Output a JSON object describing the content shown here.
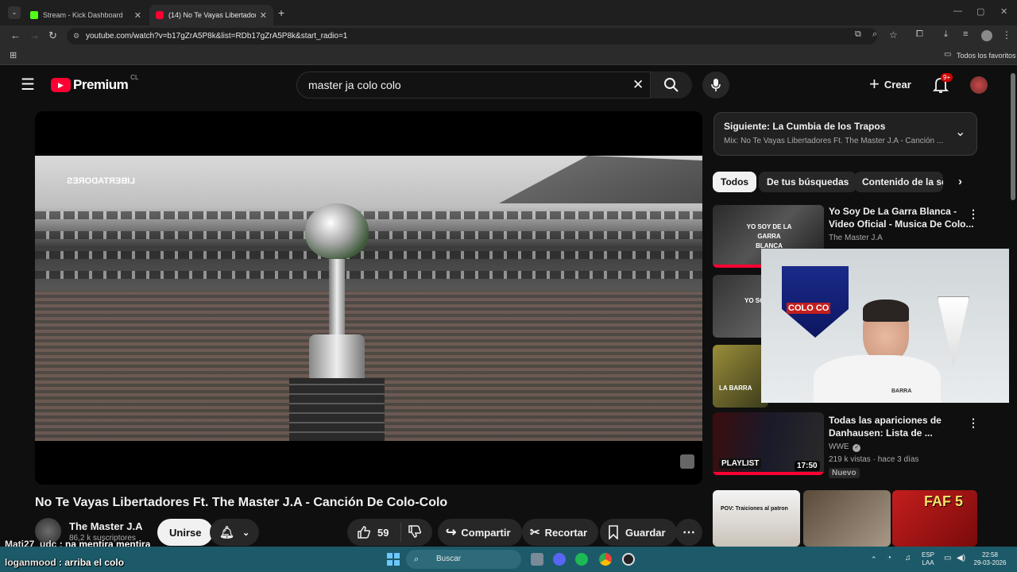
{
  "browser": {
    "tabs": [
      {
        "label": "Stream - Kick Dashboard",
        "favicon_color": "#53fc18"
      },
      {
        "label": "(14) No Te Vayas Libertadores f",
        "favicon_color": "#ff0033"
      }
    ],
    "url": "youtube.com/watch?v=b17gZrA5P8k&list=RDb17gZrA5P8k&start_radio=1",
    "bookmarks_label": "Todos los favoritos"
  },
  "youtube": {
    "logo_text": "Premium",
    "country_code": "CL",
    "search_value": "master ja colo colo",
    "create_label": "Crear",
    "notifications_badge": "9+"
  },
  "video": {
    "title": "No Te Vayas Libertadores Ft. The Master J.A - Canción De Colo-Colo",
    "overlay_text": "LIBERTADORES",
    "channel_name": "The Master J.A",
    "subscribers": "86,2 k suscriptores",
    "join_label": "Unirse",
    "likes": "59",
    "share_label": "Compartir",
    "clip_label": "Recortar",
    "save_label": "Guardar"
  },
  "sidebar": {
    "next_title": "Siguiente: La Cumbia de los Trapos",
    "next_sub": "Mix: No Te Vayas Libertadores Ft. The Master J.A - Canción ...",
    "chips": [
      "Todos",
      "De tus búsquedas",
      "Contenido de la ser"
    ],
    "recs": [
      {
        "title1": "Yo Soy De La Garra Blanca -",
        "title2": "Video Oficial - Musica De Colo...",
        "channel": "The Master J.A",
        "thumb_text": "YO SOY DE LA GARRA BLANCA"
      },
      {
        "title1": "Todas las apariciones de",
        "title2": "Danhausen: Lista de ...",
        "channel": "WWE",
        "meta": "219 k vistas · hace 3 días",
        "badge": "Nuevo",
        "duration": "17:50",
        "thumb_text": "PLAYLIST"
      }
    ],
    "thumb2_text": "YO SOY DE LA",
    "thumb3_text": "LA BARRA",
    "bottom_thumbs": [
      "POV: Traiciones al patron",
      "",
      "FAF 5"
    ]
  },
  "webcam": {
    "shield_text": "COLO CO",
    "shirt_text": "BARRA"
  },
  "chat": [
    {
      "user": "Mati27_udc",
      "message": "na mentira mentira"
    },
    {
      "user": "loganmood",
      "message": "arriba el colo"
    }
  ],
  "taskbar": {
    "search_placeholder": "Buscar",
    "lang_top": "ESP",
    "lang_bottom": "LAA",
    "time": "22:58",
    "date": "29-03-2026"
  }
}
